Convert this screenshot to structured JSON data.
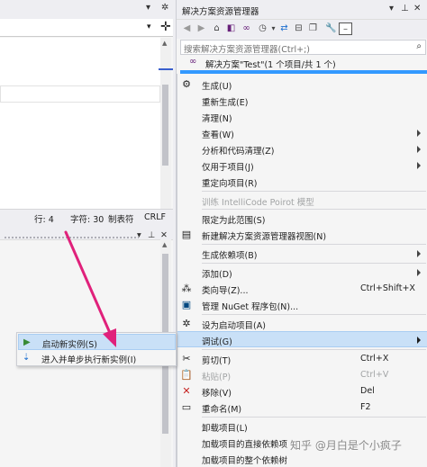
{
  "left_pane": {
    "status": {
      "line": "行: 4",
      "char": "字符: 30",
      "tabs": "制表符",
      "eol": "CRLF"
    }
  },
  "solution_explorer": {
    "title": "解决方案资源管理器",
    "search_placeholder": "搜索解决方案资源管理器(Ctrl+;)",
    "solution_label": "解决方案\"Test\"(1 个项目/共 1 个)"
  },
  "context_menu": {
    "items": [
      {
        "label": "生成(U)",
        "shortcut": "",
        "icon": "build-icon"
      },
      {
        "label": "重新生成(E)",
        "shortcut": ""
      },
      {
        "label": "清理(N)",
        "shortcut": ""
      },
      {
        "label": "查看(W)",
        "shortcut": ""
      },
      {
        "label": "分析和代码清理(Z)",
        "shortcut": ""
      },
      {
        "label": "仅用于项目(J)",
        "shortcut": ""
      },
      {
        "label": "重定向项目(R)",
        "shortcut": ""
      },
      {
        "label": "训练 IntelliCode Poirot 模型",
        "shortcut": ""
      },
      {
        "label": "限定为此范围(S)",
        "shortcut": ""
      },
      {
        "label": "新建解决方案资源管理器视图(N)",
        "shortcut": "",
        "icon": "new-view-icon"
      },
      {
        "label": "生成依赖项(B)",
        "shortcut": ""
      },
      {
        "label": "添加(D)",
        "shortcut": ""
      },
      {
        "label": "类向导(Z)...",
        "shortcut": "Ctrl+Shift+X",
        "icon": "class-wizard-icon"
      },
      {
        "label": "管理 NuGet 程序包(N)...",
        "shortcut": "",
        "icon": "nuget-icon"
      },
      {
        "label": "设为启动项目(A)",
        "shortcut": "",
        "icon": "gear-icon"
      },
      {
        "label": "调试(G)",
        "shortcut": ""
      },
      {
        "label": "剪切(T)",
        "shortcut": "Ctrl+X",
        "icon": "scissors-icon"
      },
      {
        "label": "粘贴(P)",
        "shortcut": "Ctrl+V",
        "icon": "paste-icon"
      },
      {
        "label": "移除(V)",
        "shortcut": "Del",
        "icon": "remove-icon"
      },
      {
        "label": "重命名(M)",
        "shortcut": "F2",
        "icon": "rename-icon"
      },
      {
        "label": "卸载项目(L)",
        "shortcut": ""
      },
      {
        "label": "加载项目的直接依赖项",
        "shortcut": ""
      },
      {
        "label": "加载项目的整个依赖树",
        "shortcut": ""
      }
    ]
  },
  "debug_submenu": {
    "items": [
      {
        "label": "启动新实例(S)"
      },
      {
        "label": "进入并单步执行新实例(I)"
      }
    ]
  },
  "colors": {
    "highlight": "#c9e0f7",
    "selection": "#3399ff",
    "annotation_arrow": "#e0217b",
    "remove_icon": "#c5221f",
    "start_icon": "#388a34"
  },
  "watermark": "知乎 @月白是个小疯子"
}
